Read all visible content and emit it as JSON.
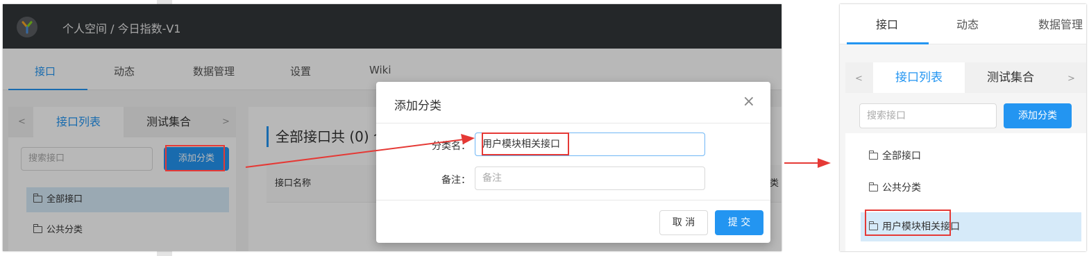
{
  "left": {
    "breadcrumb": "个人空间 / 今日指数-V1",
    "tabs": [
      "接口",
      "动态",
      "数据管理",
      "设置",
      "Wiki"
    ],
    "sidebar_tabs": [
      "接口列表",
      "测试集合"
    ],
    "arrow_left": "<",
    "arrow_right": ">",
    "search_placeholder": "搜索接口",
    "add_category": "添加分类",
    "tree": [
      "全部接口",
      "公共分类"
    ],
    "main_title": "全部接口共 (0) 个",
    "table_header": "接口名称",
    "table_header_right": "类",
    "modal": {
      "title": "添加分类",
      "close": "×",
      "name_label": "分类名：",
      "name_value": "用户模块相关接口",
      "note_label": "备注：",
      "note_placeholder": "备注",
      "cancel": "取 消",
      "submit": "提 交"
    }
  },
  "right": {
    "tabs": [
      "接口",
      "动态",
      "数据管理"
    ],
    "sidebar_tabs": [
      "接口列表",
      "测试集合"
    ],
    "arrow_left": "<",
    "arrow_right": ">",
    "search_placeholder": "搜索接口",
    "add_category": "添加分类",
    "tree": [
      "全部接口",
      "公共分类",
      "用户模块相关接口"
    ]
  },
  "colors": {
    "accent": "#2395f1",
    "topbar": "#32363a",
    "highlight": "#e53935",
    "selected_bg": "#d6eaf9"
  }
}
